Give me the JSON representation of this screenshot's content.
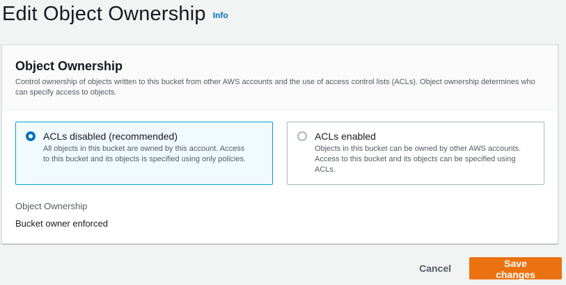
{
  "header": {
    "title": "Edit Object Ownership",
    "info_label": "Info"
  },
  "section": {
    "title": "Object Ownership",
    "description": "Control ownership of objects written to this bucket from other AWS accounts and the use of access control lists (ACLs). Object ownership determines who can specify access to objects."
  },
  "options": [
    {
      "label": "ACLs disabled (recommended)",
      "description": "All objects in this bucket are owned by this account. Access to this bucket and its objects is specified using only policies.",
      "selected": true
    },
    {
      "label": "ACLs enabled",
      "description": "Objects in this bucket can be owned by other AWS accounts. Access to this bucket and its objects can be specified using ACLs.",
      "selected": false
    }
  ],
  "ownership": {
    "key": "Object Ownership",
    "value": "Bucket owner enforced"
  },
  "actions": {
    "cancel_label": "Cancel",
    "save_label": "Save changes"
  },
  "colors": {
    "accent": "#0073bb",
    "primary_button": "#ec7211",
    "selected_border": "#00a1c9"
  }
}
